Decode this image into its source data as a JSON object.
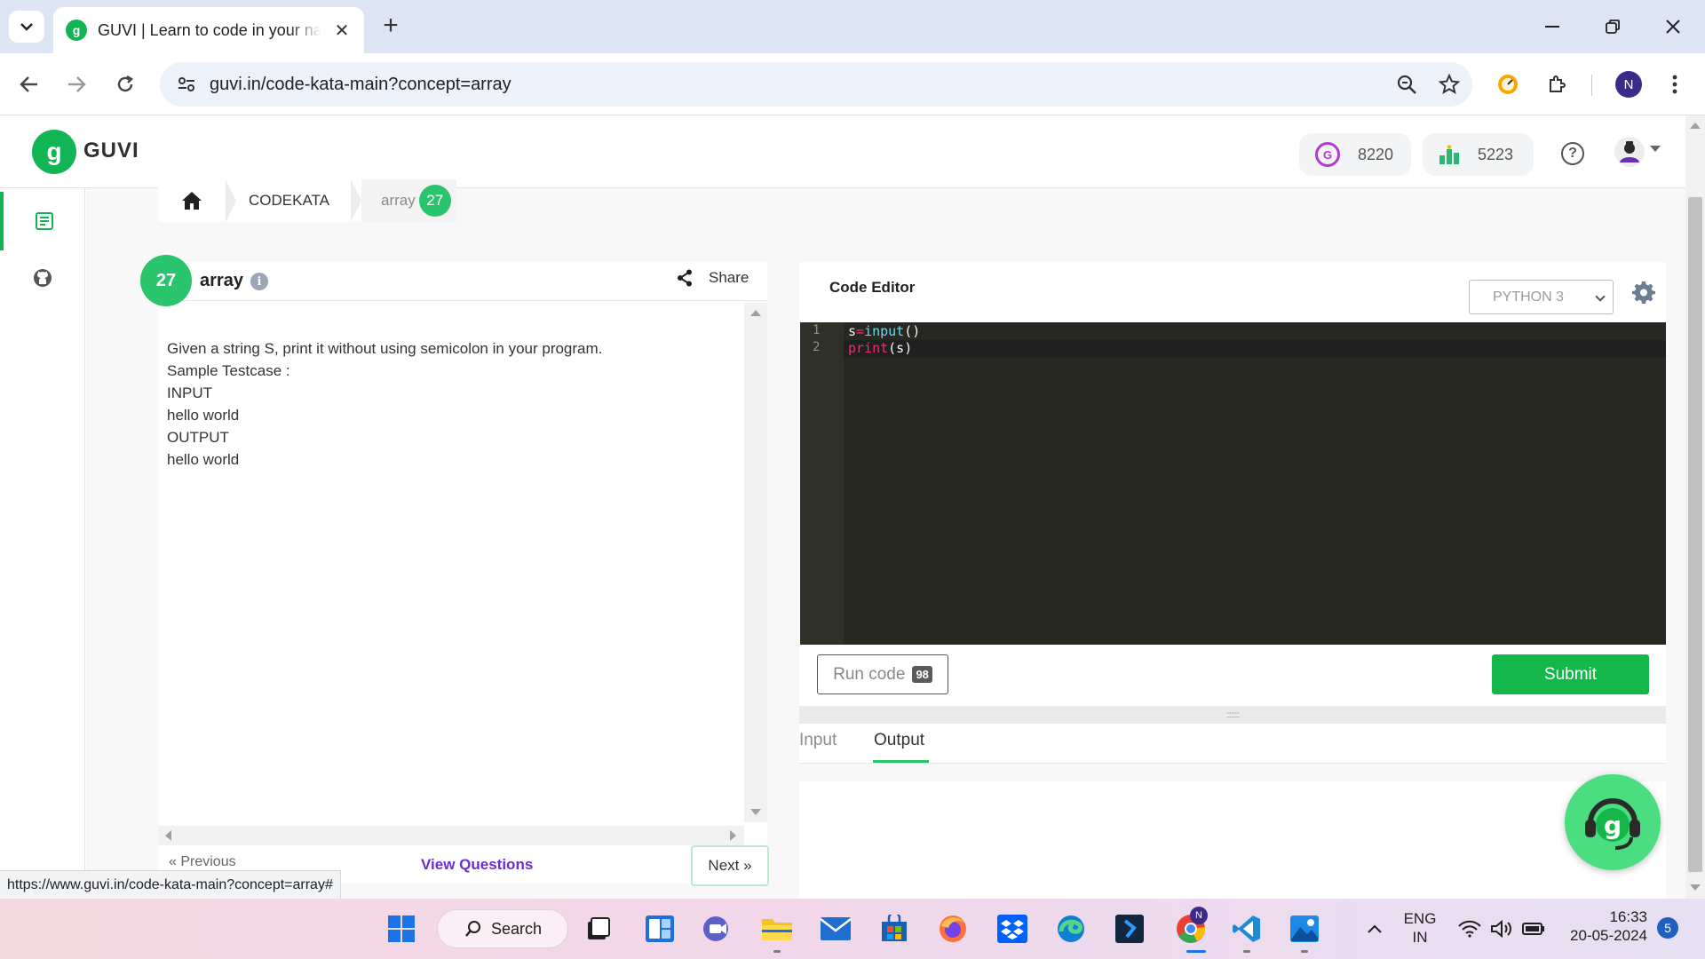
{
  "browser": {
    "tab_title": "GUVI | Learn to code in your native language",
    "url": "guvi.in/code-kata-main?concept=array",
    "profile_initial": "N"
  },
  "header": {
    "logo_glyph": "g",
    "logo_text": "GUVI",
    "geek_points": "8220",
    "rank": "5223",
    "help_glyph": "?"
  },
  "breadcrumb": {
    "section": "CODEKATA",
    "current": "array",
    "count": "27"
  },
  "problem": {
    "badge": "27",
    "title": "array",
    "share_label": "Share",
    "lines": [
      "Given a string S, print it without using semicolon in your program.",
      "Sample Testcase :",
      "INPUT",
      "hello world",
      "OUTPUT",
      "hello world"
    ],
    "prev_label": "«  Previous",
    "view_questions_label": "View Questions",
    "next_label": "Next  »"
  },
  "editor": {
    "title": "Code Editor",
    "language": "PYTHON 3",
    "line_numbers": [
      "1",
      "2"
    ],
    "code": {
      "l1_var": "s",
      "l1_op": "=",
      "l1_fn": "input",
      "l1_paren": "()",
      "l2_kw": "print",
      "l2_args": "(s)"
    },
    "run_label": "Run code",
    "run_count": "98",
    "submit_label": "Submit",
    "resize_grip": "::::::::"
  },
  "io": {
    "input_tab": "Input",
    "output_tab": "Output",
    "active": "Output"
  },
  "status_url": "https://www.guvi.in/code-kata-main?concept=array#",
  "taskbar": {
    "search_label": "Search",
    "lang_line1": "ENG",
    "lang_line2": "IN",
    "time": "16:33",
    "date": "20-05-2024",
    "notification_count": "5",
    "chrome_badge": "N"
  },
  "colors": {
    "brand_green": "#12b553",
    "badge_green": "#2ac46c",
    "link_purple": "#6b2cd4",
    "editor_bg": "#272822"
  }
}
